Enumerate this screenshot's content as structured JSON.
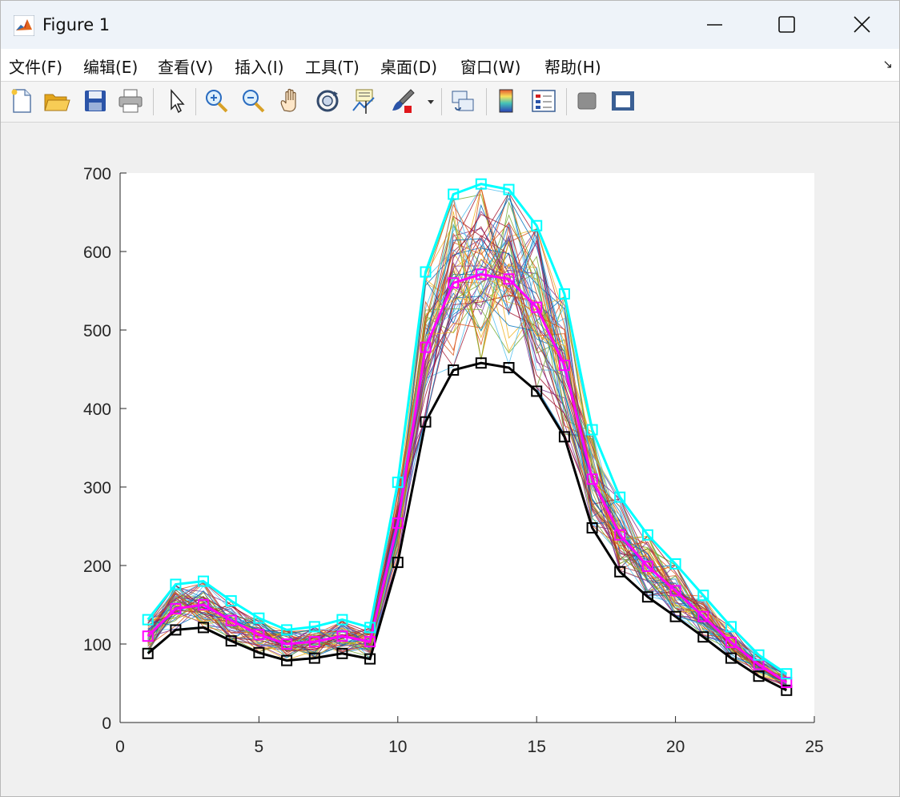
{
  "window": {
    "title": "Figure 1",
    "controls": [
      "minimize",
      "maximize",
      "close"
    ]
  },
  "menu": [
    {
      "label": "文件(F)"
    },
    {
      "label": "编辑(E)"
    },
    {
      "label": "查看(V)"
    },
    {
      "label": "插入(I)"
    },
    {
      "label": "工具(T)"
    },
    {
      "label": "桌面(D)"
    },
    {
      "label": "窗口(W)"
    },
    {
      "label": "帮助(H)"
    }
  ],
  "toolbar": {
    "buttons": [
      {
        "icon": "new-figure-icon"
      },
      {
        "icon": "open-file-icon"
      },
      {
        "icon": "save-icon"
      },
      {
        "icon": "print-icon"
      },
      {
        "icon": "edit-plot-arrow-icon"
      },
      {
        "icon": "zoom-in-icon"
      },
      {
        "icon": "zoom-out-icon"
      },
      {
        "icon": "pan-hand-icon"
      },
      {
        "icon": "rotate-3d-icon"
      },
      {
        "icon": "data-cursor-icon"
      },
      {
        "icon": "brush-icon"
      },
      {
        "icon": "link-plot-icon"
      },
      {
        "icon": "colorbar-icon"
      },
      {
        "icon": "legend-icon"
      },
      {
        "icon": "hide-plot-tools-icon"
      },
      {
        "icon": "show-plot-tools-icon"
      }
    ]
  },
  "chart_data": {
    "type": "line",
    "title": "",
    "xlabel": "",
    "ylabel": "",
    "xlim": [
      0,
      25
    ],
    "ylim": [
      0,
      700
    ],
    "xticks": [
      0,
      5,
      10,
      15,
      20,
      25
    ],
    "yticks": [
      0,
      100,
      200,
      300,
      400,
      500,
      600,
      700
    ],
    "grid": false,
    "x": [
      1,
      2,
      3,
      4,
      5,
      6,
      7,
      8,
      9,
      10,
      11,
      12,
      13,
      14,
      15,
      16,
      17,
      18,
      19,
      20,
      21,
      22,
      23,
      24
    ],
    "series": [
      {
        "role": "upper envelope",
        "color": "#00ffff",
        "marker": "square",
        "values": [
          131,
          176,
          180,
          155,
          133,
          118,
          122,
          131,
          121,
          306,
          574,
          673,
          686,
          679,
          633,
          546,
          373,
          287,
          239,
          202,
          162,
          122,
          86,
          62
        ]
      },
      {
        "role": "mean",
        "color": "#ff00ff",
        "marker": "square",
        "values": [
          110,
          145,
          150,
          130,
          112,
          100,
          103,
          110,
          103,
          254,
          478,
          560,
          571,
          565,
          529,
          455,
          310,
          239,
          199,
          168,
          135,
          102,
          74,
          51
        ]
      },
      {
        "role": "lower envelope",
        "color": "#000000",
        "marker": "square",
        "values": [
          88,
          118,
          121,
          104,
          89,
          79,
          82,
          88,
          81,
          204,
          383,
          449,
          458,
          452,
          422,
          364,
          248,
          192,
          160,
          135,
          109,
          82,
          59,
          41
        ]
      }
    ],
    "background_traces": {
      "description_count": 60,
      "palette": [
        "#0072bd",
        "#d95319",
        "#edb120",
        "#7e2f8e",
        "#77ac30",
        "#4dbeee",
        "#a2142f"
      ]
    }
  }
}
